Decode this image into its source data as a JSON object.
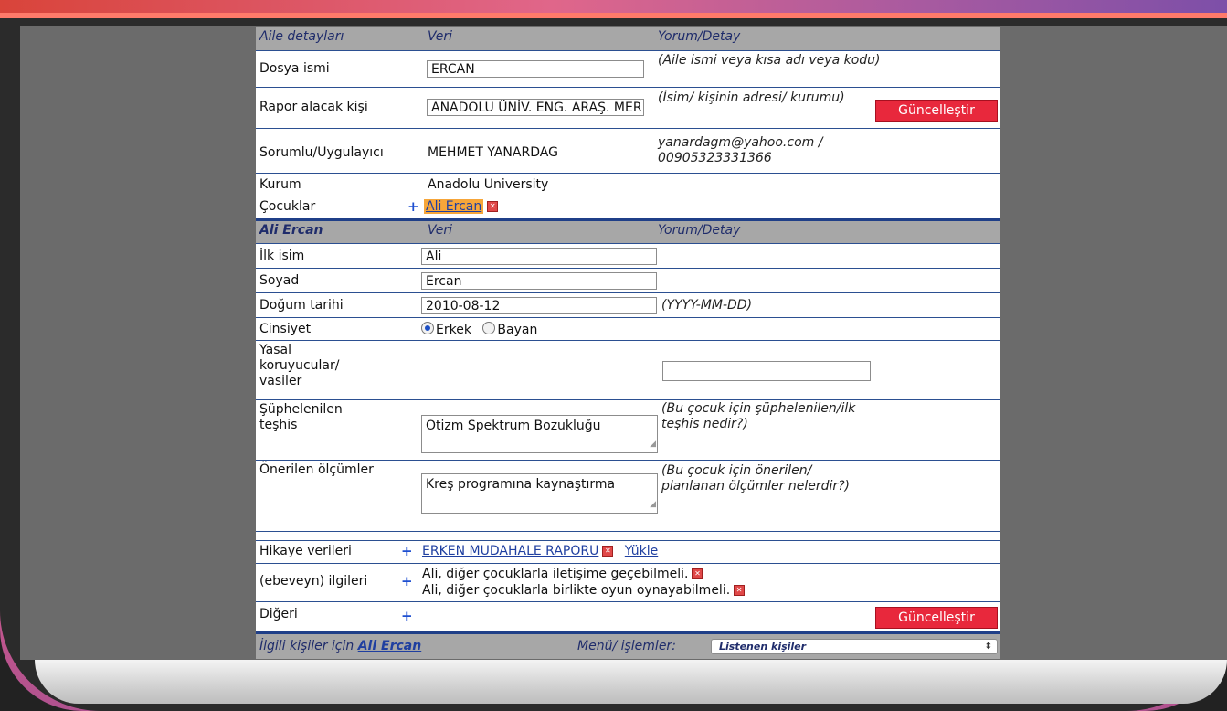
{
  "family_header": {
    "col1": "Aile detayları",
    "col2": "Veri",
    "col3": "Yorum/Detay"
  },
  "file_name": {
    "label": "Dosya ismi",
    "value": "ERCAN",
    "comment": "(Aile ismi veya kısa adı veya kodu)"
  },
  "report_recipient": {
    "label": "Rapor alacak kişi",
    "value": "ANADOLU ÜNİV. ENG. ARAŞ. MERK.",
    "comment": "(İsim/ kişinin adresi/ kurumu)"
  },
  "update_button_1": "Güncelleştir",
  "responsible": {
    "label": "Sorumlu/Uygulayıcı",
    "value": "MEHMET YANARDAG",
    "comment": "yanardagm@yahoo.com / 00905323331366"
  },
  "institution": {
    "label": "Kurum",
    "value": "Anadolu University"
  },
  "children": {
    "label": "Çocuklar",
    "plus": "+",
    "child_link": "Ali Ercan"
  },
  "child_header": {
    "col1": "Ali Ercan",
    "col2": "Veri",
    "col3": "Yorum/Detay"
  },
  "first_name": {
    "label": "İlk isim",
    "value": "Ali"
  },
  "last_name": {
    "label": "Soyad",
    "value": "Ercan"
  },
  "birth_date": {
    "label": "Doğum tarihi",
    "value": "2010-08-12",
    "comment": "(YYYY-MM-DD)"
  },
  "gender": {
    "label": "Cinsiyet",
    "option_male": "Erkek",
    "option_female": "Bayan",
    "selected": "Erkek"
  },
  "guardians": {
    "label": "Yasal koruyucular/ vasiler",
    "value": ""
  },
  "suspected_diagnosis": {
    "label": "Şüphelenilen teşhis",
    "value": "Otizm Spektrum Bozukluğu",
    "comment": "(Bu çocuk için şüphelenilen/ilk teşhis nedir?)"
  },
  "recommended_measures": {
    "label": "Önerilen ölçümler",
    "value": "Kreş programına kaynaştırma",
    "comment": "(Bu çocuk için önerilen/ planlanan ölçümler nelerdir?)"
  },
  "story_data": {
    "label": "Hikaye verileri",
    "plus": "+",
    "link": "ERKEN MUDAHALE RAPORU",
    "upload": "Yükle"
  },
  "parent_concerns": {
    "label": "(ebeveyn) ilgileri",
    "plus": "+",
    "items": [
      "Ali, diğer çocuklarla iletişime geçebilmeli.",
      "Ali, diğer çocuklarla birlikte oyun oynayabilmeli."
    ]
  },
  "other": {
    "label": "Diğeri",
    "plus": "+"
  },
  "update_button_2": "Güncelleştir",
  "footer": {
    "prefix": "İlgili kişiler için",
    "child_link": "Ali Ercan",
    "menu_label": "Menü/ işlemler:",
    "menu_selected": "Listenen kişiler"
  },
  "colors": {
    "header_bg": "#a7a7a7",
    "button_red": "#e8283c",
    "link_blue": "#1f3fa0",
    "highlight_orange": "#f6a63a",
    "screen_gray": "#6b6b6b"
  }
}
